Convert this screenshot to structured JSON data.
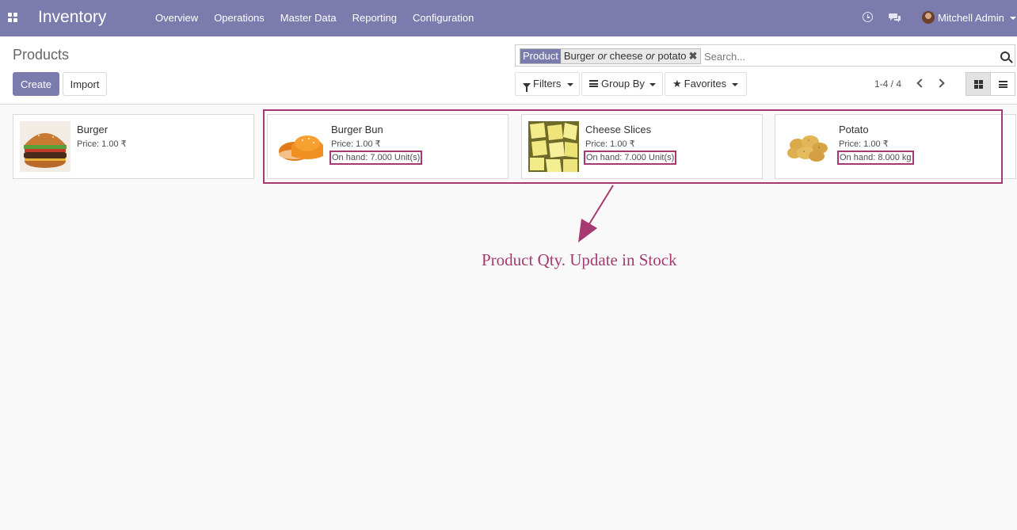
{
  "app": {
    "title": "Inventory",
    "menu": [
      "Overview",
      "Operations",
      "Master Data",
      "Reporting",
      "Configuration"
    ],
    "user": "Mitchell Admin"
  },
  "control_panel": {
    "page_title": "Products",
    "create_label": "Create",
    "import_label": "Import",
    "search": {
      "facet_label": "Product",
      "facet_terms": [
        "Burger",
        "cheese",
        "potato"
      ],
      "facet_separator": "or",
      "placeholder": "Search..."
    },
    "filters_label": "Filters",
    "groupby_label": "Group By",
    "favorites_label": "Favorites",
    "pager": "1-4 / 4"
  },
  "products": [
    {
      "name": "Burger",
      "price": "Price: 1.00 ₹",
      "on_hand": ""
    },
    {
      "name": "Burger Bun",
      "price": "Price: 1.00 ₹",
      "on_hand": "On hand: 7.000 Unit(s)"
    },
    {
      "name": "Cheese Slices",
      "price": "Price: 1.00 ₹",
      "on_hand": "On hand: 7.000 Unit(s)"
    },
    {
      "name": "Potato",
      "price": "Price: 1.00 ₹",
      "on_hand": "On hand: 8.000 kg"
    }
  ],
  "annotation": "Product Qty. Update in Stock",
  "colors": {
    "brand": "#7c7bad",
    "annotation": "#a63a70"
  }
}
